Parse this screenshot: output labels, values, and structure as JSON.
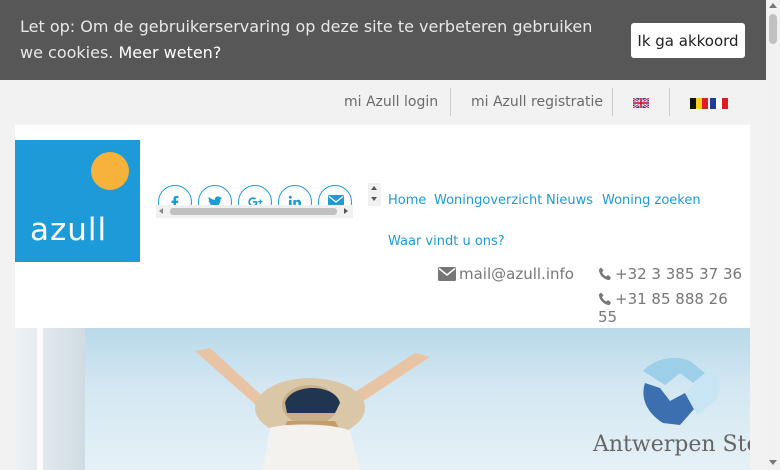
{
  "cookie": {
    "message": "Let op: Om de gebruikerservaring op deze site te verbeteren gebruiken we cookies.",
    "link": "Meer weten?",
    "button": "Ik ga akkoord"
  },
  "topnav": {
    "login": "mi Azull login",
    "register": "mi Azull registratie"
  },
  "logo": {
    "text": "azull"
  },
  "mainnav": {
    "items": [
      "Home",
      "Woningoverzicht",
      "Nieuws",
      "Woning zoeken",
      "Waar vindt u ons?"
    ]
  },
  "contact": {
    "email": "mail@azull.info",
    "phone1": "+32 3 385 37 36",
    "phone2": "+31 85 888 26 55"
  },
  "hero": {
    "store_name": "Antwerpen Store"
  },
  "colors": {
    "brand": "#1d9bd8",
    "sun": "#f7b23b",
    "cookie_bar": "#575757"
  },
  "icons": {
    "social": [
      "facebook-icon",
      "twitter-icon",
      "google-plus-icon",
      "linkedin-icon",
      "email-icon"
    ],
    "flags": [
      "uk-flag-icon",
      "belgium-flag-icon",
      "france-flag-icon"
    ]
  }
}
